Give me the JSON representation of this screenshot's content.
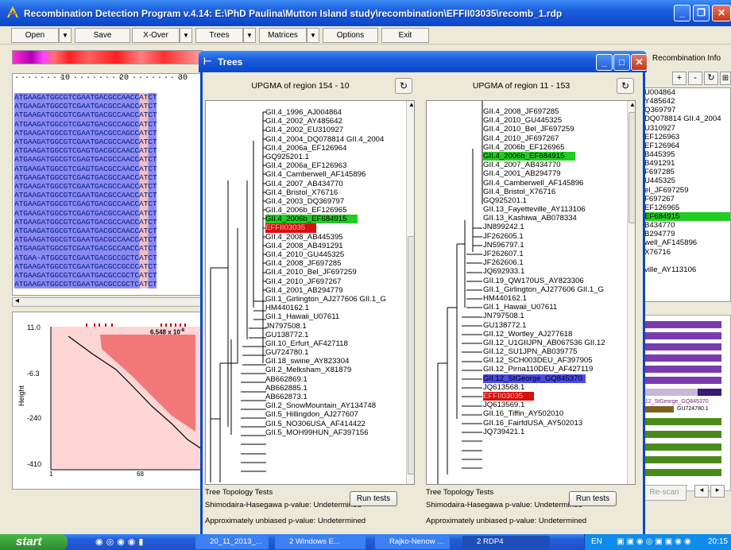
{
  "window": {
    "title": "Recombination Detection Program v.4.14:  E:\\PhD Paulina\\Mutton Island study\\recombination\\EFFII03035\\recomb_1.rdp",
    "minimize": "_",
    "maximize": "❐",
    "close": "✕"
  },
  "toolbar": {
    "open": "Open",
    "save": "Save",
    "xover": "X-Over",
    "trees": "Trees",
    "matrices": "Matrices",
    "options": "Options",
    "exit": "Exit"
  },
  "ruler": {
    "t10": "10",
    "t20": "20",
    "t30": "30"
  },
  "sequences": [
    "ATGAAGATGGCGTCGAATGACGCCAACCATCT",
    "ATGAAGATGGCGTCGAATGACGCCAACCATCT",
    "ATGAAGATGGCGTCGAATGACGCCAACCATCT",
    "ATGAAGATGGCGTCGAGTGACGCCAGCCATCT",
    "ATGAAGATGGCGTCGAATGACGCCAGCCATCT",
    "ATGAAGATGGCGTCGAATGACGCCAACCATCT",
    "ATGAAGATGGCGTCGAGTGACGCCAACCATCT",
    "ATGAAGATGGCGTCGAGTGACGCCAACCATCT",
    "ATGAAGATGGCGTCGAGTGACGCCAACCATCT",
    "ATGAAGATGGCGTCGAGTGACGCCAACCATCT",
    "ATGAAGATGGCGTCGAATGACGCCAACCATCT",
    "ATGAAGATGGCGTCGAATGACGCCAACCATCT",
    "ATGAAGATGGCGTCGAGTGACGCCAACCATCT",
    "ATGAAGATGGCGTCGAGTGACGCCAACCATCT",
    "ATGAAGATGGCGTCGAGTGACGCCAACCATCT",
    "ATGAAGATGGCGTCGAATGACGCCAACCATCT",
    "ATGAAGATGGCGTCGAATGACGCCAACCATCT",
    "ATGAAGATGGCGTCGAATGACGCCAACCATCT",
    "ATGAA-ATGGCGTCGAATGACGCCGCTCATCT",
    "ATGAAGATGGCGTCGAATGACGCCGCCCATCT",
    "ATGAAGATGGCGTCGAATGACGCCGCTCATCT",
    "ATGAAGATGGCGTCGAATGACGCCGCTCATCT"
  ],
  "plot": {
    "ylabel": "Height",
    "yticks": [
      "11.0",
      "-6.3",
      "-240",
      "-410"
    ],
    "xtick1": "1",
    "xtick2": "68",
    "annotation": "6.548 x 10",
    "annot_exp": "-8"
  },
  "recomb_info": {
    "tab": "Recombination Info",
    "list": [
      "U004864",
      "Y485642",
      "Q369797",
      "DQ078814 GII.4_2004",
      "U310927",
      "EF126963",
      "EF126964",
      "B445395",
      "B491291",
      "F697285",
      "U445325",
      "el_JF697259",
      "F697267",
      "EF126965",
      "EF684915",
      "B434770",
      "B294779",
      "well_AF145896",
      "X76716",
      "",
      "ville_AY113106"
    ],
    "bar_label1": "II.12_StGeorge_GQ845370",
    "bar_label2": "GU724780.1",
    "rescan": "Re-scan"
  },
  "dialog": {
    "title": "Trees",
    "left": {
      "header": "UPGMA of region 154 - 10",
      "leaves": [
        "GII.4_1996_AJ004864",
        "GII.4_2002_AY485642",
        "GII.4_2002_EU310927",
        "GII.4_2004_DQ078814 GII.4_2004",
        "GII.4_2006a_EF126964",
        "GQ925201.1",
        "GII.4_2006a_EF126963",
        "GII.4_Camberwell_AF145896",
        "GII.4_2007_AB434770",
        "GII.4_Bristol_X76716",
        "GII.4_2003_DQ369797",
        "GII.4_2006b_EF126965",
        "GII.4_2006b_EF684915",
        "EFFII03035",
        "GII.4_2008_AB445395",
        "GII.4_2008_AB491291",
        "GII.4_2010_GU445325",
        "GII.4_2008_JF697285",
        "GII.4_2010_Bel_JF697259",
        "GII.4_2010_JF697267",
        "GII.4_2001_AB294779",
        "GII.1_Girlington_AJ277606 GII.1_G",
        "HM440162.1",
        "GII.1_Hawaii_U07611",
        "JN797508.1",
        "GU138772.1",
        "GII.10_Erfurt_AF427118",
        "GU724780.1",
        "GII.18_swine_AY823304",
        "GII.2_Melksham_X81879",
        "AB662869.1",
        "AB662885.1",
        "AB662873.1",
        "GII.2_SnowMountain_AY134748",
        "GII.5_Hillingdon_AJ277607",
        "GII.5_NO306USA_AF414422",
        "GII.5_MOH99HUN_AF397156"
      ]
    },
    "right": {
      "header": "UPGMA of region 11 - 153",
      "leaves": [
        "GII.4_2008_JF697285",
        "GII.4_2010_GU445325",
        "GII.4_2010_Bel_JF697259",
        "GII.4_2010_JF697267",
        "GII.4_2006b_EF126965",
        "GII.4_2006b_EF684915",
        "GII.4_2007_AB434770",
        "GII.4_2001_AB294779",
        "GII.4_Camberwell_AF145896",
        "GII.4_Bristol_X76716",
        "GQ925201.1",
        "GII.13_Fayetteville_AY113106",
        "GII.13_Kashiwa_AB078334",
        "JN899242.1",
        "JF262605.1",
        "JN596797.1",
        "JF262607.1",
        "JF262606.1",
        "JQ692933.1",
        "GII.19_QW170US_AY823306",
        "GII.1_Girlington_AJ277606 GII.1_G",
        "HM440162.1",
        "GII.1_Hawaii_U07611",
        "JN797508.1",
        "GU138772.1",
        "GII.12_Wortley_AJ277618",
        "GII.12_U1GIIJPN_AB067536 GII.12",
        "GII.12_SU1JPN_AB039775",
        "GII.12_SCH003DEU_AF397905",
        "GII.12_Pirna110DEU_AF427119",
        "GII.12_StGeorge_GQ845370",
        "JQ613568.1",
        "EFFII03035",
        "JQ613569.1",
        "GII.16_Tiffin_AY502010",
        "GII.16_FairfdUSA_AY502013",
        "JQ739421.1"
      ]
    },
    "tests": {
      "title": "Tree Topology Tests",
      "sh": "Shimodaira-Hasegawa p-value: Undetermined",
      "au": "Approximately unbiased p-value: Undetermined",
      "run": "Run tests"
    }
  },
  "taskbar": {
    "start": "start",
    "tasks": [
      "20_11_2013_...",
      "2 Windows E...",
      "Rajko-Nenow ...",
      "2 RDP4"
    ],
    "lang": "EN",
    "clock": "20:15"
  },
  "colors": {
    "accent": "#0a46c8",
    "highlight_green": "#22cc22",
    "highlight_red": "#d81010",
    "highlight_blue": "#4a4ae8"
  }
}
